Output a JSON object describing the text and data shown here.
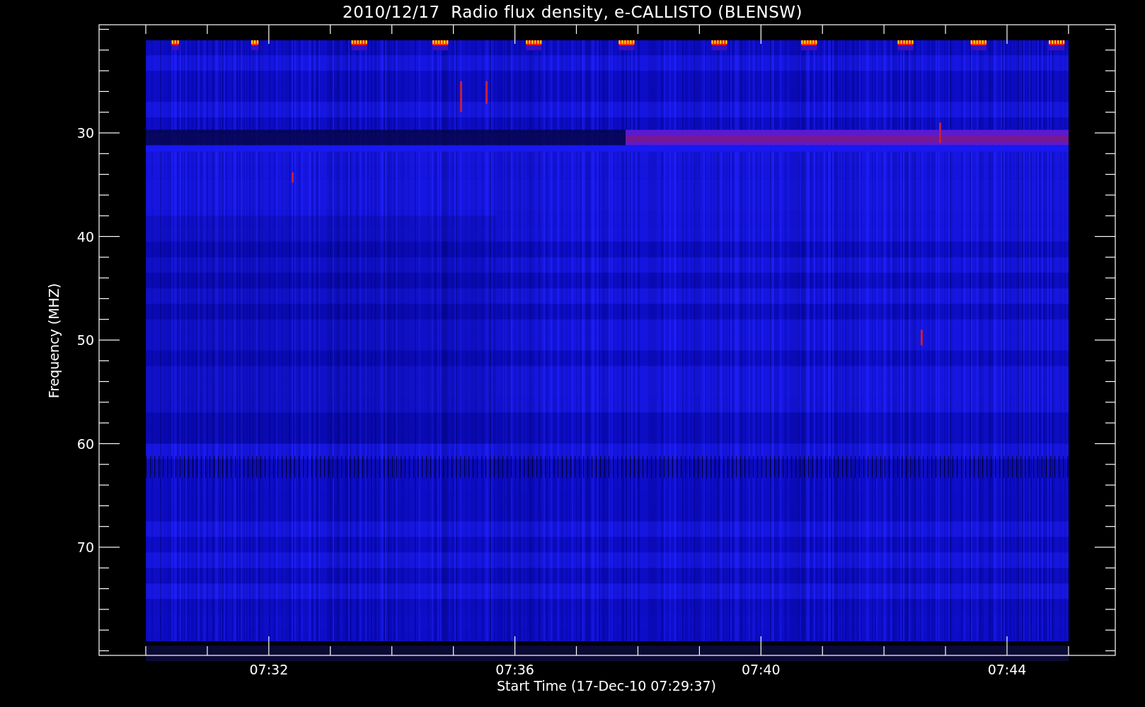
{
  "title": "2010/12/17  Radio flux density, e-CALLISTO (BLENSW)",
  "y_axis": {
    "label": "Frequency (MHZ)",
    "ticks": [
      "30",
      "40",
      "50",
      "60",
      "70"
    ]
  },
  "x_axis": {
    "label": "Start Time (17-Dec-10 07:29:37)",
    "ticks": [
      "07:32",
      "07:36",
      "07:40",
      "07:44"
    ]
  }
}
